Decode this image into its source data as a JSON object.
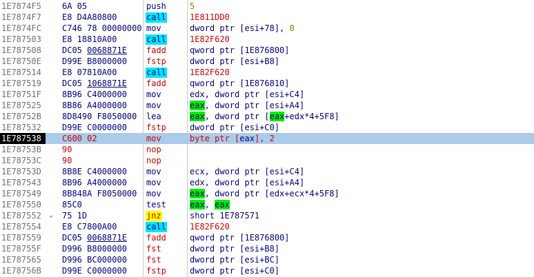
{
  "colors": {
    "background": "#ffffff",
    "address_text": "#707070",
    "selected_row": "#aacbe9",
    "selected_address_bg": "#000000",
    "call_highlight": "#00e5ff",
    "jump_highlight": "#ffff00",
    "register_highlight": "#00ee00",
    "red_text": "#d00000"
  },
  "rows": [
    {
      "addr": "1E7874F5",
      "hex": "6A 05",
      "mn": "push",
      "mstyle": "plain",
      "args": [
        {
          "t": "5",
          "c": "num"
        }
      ]
    },
    {
      "addr": "1E7874F7",
      "hex": "E8 D4A80800",
      "mn": "call",
      "mstyle": "call",
      "args": [
        {
          "t": "1E811DD0",
          "c": "red"
        }
      ]
    },
    {
      "addr": "1E7874FC",
      "hex": "C746 78 00000000",
      "mn": "mov",
      "mstyle": "plain",
      "args": [
        {
          "t": "dword ptr [esi+78], ",
          "c": "kw"
        },
        {
          "t": "0",
          "c": "num"
        }
      ]
    },
    {
      "addr": "1E787503",
      "hex": "E8 18810A00",
      "mn": "call",
      "mstyle": "call",
      "args": [
        {
          "t": "1E82F620",
          "c": "red"
        }
      ]
    },
    {
      "addr": "1E787508",
      "hex": "DC05 0068871E",
      "hexul": "0068871E",
      "mn": "fadd",
      "mstyle": "red",
      "args": [
        {
          "t": "qword ptr [1E876800]",
          "c": "kw"
        }
      ]
    },
    {
      "addr": "1E78750E",
      "hex": "D99E B8000000",
      "mn": "fstp",
      "mstyle": "red",
      "args": [
        {
          "t": "dword ptr [esi+B8]",
          "c": "kw"
        }
      ]
    },
    {
      "addr": "1E787514",
      "hex": "E8 07810A00",
      "mn": "call",
      "mstyle": "call",
      "args": [
        {
          "t": "1E82F620",
          "c": "red"
        }
      ]
    },
    {
      "addr": "1E787519",
      "hex": "DC05 1068871E",
      "hexul": "1068871E",
      "mn": "fadd",
      "mstyle": "red",
      "args": [
        {
          "t": "qword ptr [1E876810]",
          "c": "kw"
        }
      ]
    },
    {
      "addr": "1E78751F",
      "hex": "8B96 C4000000",
      "mn": "mov",
      "mstyle": "plain",
      "args": [
        {
          "t": "edx, dword ptr [esi+C4]",
          "c": "kw"
        }
      ]
    },
    {
      "addr": "1E787525",
      "hex": "8B86 A4000000",
      "mn": "mov",
      "mstyle": "plain",
      "args": [
        {
          "t": "eax",
          "c": "reg"
        },
        {
          "t": ", dword ptr [esi+A4]",
          "c": "kw"
        }
      ]
    },
    {
      "addr": "1E78752B",
      "hex": "8D8490 F8050000",
      "mn": "lea",
      "mstyle": "plain",
      "args": [
        {
          "t": "eax",
          "c": "reg"
        },
        {
          "t": ", dword ptr [",
          "c": "kw"
        },
        {
          "t": "eax",
          "c": "reg"
        },
        {
          "t": "+edx*4+5F8]",
          "c": "kw"
        }
      ]
    },
    {
      "addr": "1E787532",
      "hex": "D99E C0000000",
      "mn": "fstp",
      "mstyle": "red",
      "args": [
        {
          "t": "dword ptr [esi+C0]",
          "c": "kw"
        }
      ]
    },
    {
      "addr": "1E787538",
      "hex": "C600 02",
      "mn": "mov",
      "mstyle": "red",
      "selected": true,
      "args": [
        {
          "t": "byte ptr [",
          "c": "red"
        },
        {
          "t": "eax",
          "c": "regsel"
        },
        {
          "t": "], 2",
          "c": "red"
        }
      ]
    },
    {
      "addr": "1E78753B",
      "hex": "90",
      "red": true,
      "mn": "nop",
      "mstyle": "red",
      "args": []
    },
    {
      "addr": "1E78753C",
      "hex": "90",
      "red": true,
      "mn": "nop",
      "mstyle": "red",
      "args": []
    },
    {
      "addr": "1E78753D",
      "hex": "8B8E C4000000",
      "mn": "mov",
      "mstyle": "plain",
      "args": [
        {
          "t": "ecx, dword ptr [esi+C4]",
          "c": "kw"
        }
      ]
    },
    {
      "addr": "1E787543",
      "hex": "8B96 A4000000",
      "mn": "mov",
      "mstyle": "plain",
      "args": [
        {
          "t": "edx, dword ptr [esi+A4]",
          "c": "kw"
        }
      ]
    },
    {
      "addr": "1E787549",
      "hex": "8B848A F8050000",
      "mn": "mov",
      "mstyle": "plain",
      "args": [
        {
          "t": "eax",
          "c": "reg"
        },
        {
          "t": ", dword ptr [edx+ecx*4+5F8]",
          "c": "kw"
        }
      ]
    },
    {
      "addr": "1E787550",
      "hex": "85C0",
      "mn": "test",
      "mstyle": "plain",
      "args": [
        {
          "t": "eax",
          "c": "reg"
        },
        {
          "t": ", ",
          "c": "kw"
        },
        {
          "t": "eax",
          "c": "reg"
        }
      ]
    },
    {
      "addr": "1E787552",
      "hex": "75 1D",
      "mn": "jnz",
      "mstyle": "jnz",
      "arrow": "⌄",
      "args": [
        {
          "t": "short 1E787571",
          "c": "kw"
        }
      ]
    },
    {
      "addr": "1E787554",
      "hex": "E8 C7800A00",
      "mn": "call",
      "mstyle": "call",
      "args": [
        {
          "t": "1E82F620",
          "c": "red"
        }
      ]
    },
    {
      "addr": "1E787559",
      "hex": "DC05 0068871E",
      "hexul": "0068871E",
      "mn": "fadd",
      "mstyle": "red",
      "args": [
        {
          "t": "qword ptr [1E876800]",
          "c": "kw"
        }
      ]
    },
    {
      "addr": "1E78755F",
      "hex": "D996 B8000000",
      "mn": "fst",
      "mstyle": "red",
      "args": [
        {
          "t": "dword ptr [esi+B8]",
          "c": "kw"
        }
      ]
    },
    {
      "addr": "1E787565",
      "hex": "D996 BC000000",
      "mn": "fst",
      "mstyle": "red",
      "args": [
        {
          "t": "dword ptr [esi+BC]",
          "c": "kw"
        }
      ]
    },
    {
      "addr": "1E78756B",
      "hex": "D99E C0000000",
      "mn": "fstp",
      "mstyle": "red",
      "args": [
        {
          "t": "dword ptr [esi+C0]",
          "c": "kw"
        }
      ]
    }
  ]
}
